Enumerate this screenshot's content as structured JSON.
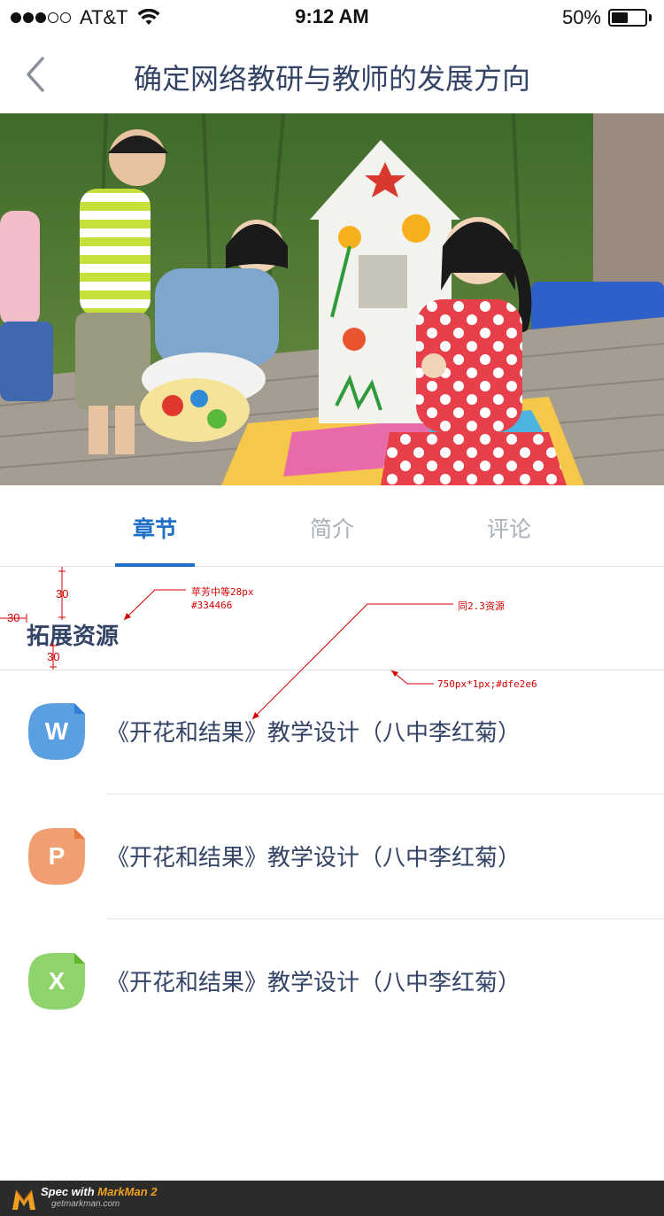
{
  "status_bar": {
    "carrier": "AT&T",
    "time": "9:12 AM",
    "battery": "50%",
    "battery_level": 0.5
  },
  "nav": {
    "title": "确定网络教研与教师的发展方向",
    "back_icon": "chevron-left-icon"
  },
  "tabs": [
    {
      "label": "章节",
      "active": true
    },
    {
      "label": "简介",
      "active": false
    },
    {
      "label": "评论",
      "active": false
    }
  ],
  "section": {
    "title": "拓展资源"
  },
  "annotations": {
    "font_spec": "苹芳中等28px",
    "color_spec": "#334466",
    "same_as": "同2.3资源",
    "line_spec": "750px*1px;#dfe2e6",
    "spacing_top": "30",
    "spacing_left": "30",
    "spacing_bottom": "30"
  },
  "resources": [
    {
      "type_letter": "W",
      "color": "#5a9fe0",
      "fold_color": "#2f7dd4",
      "title": "《开花和结果》教学设计（八中李红菊）"
    },
    {
      "type_letter": "P",
      "color": "#f0a070",
      "fold_color": "#e8773e",
      "title": "《开花和结果》教学设计（八中李红菊）"
    },
    {
      "type_letter": "X",
      "color": "#8fd46a",
      "fold_color": "#5cb82e",
      "title": "《开花和结果》教学设计（八中李红菊）"
    }
  ],
  "footer": {
    "prefix": "Spec with ",
    "brand": "MarkMan 2",
    "url": "getmarkman.com"
  }
}
